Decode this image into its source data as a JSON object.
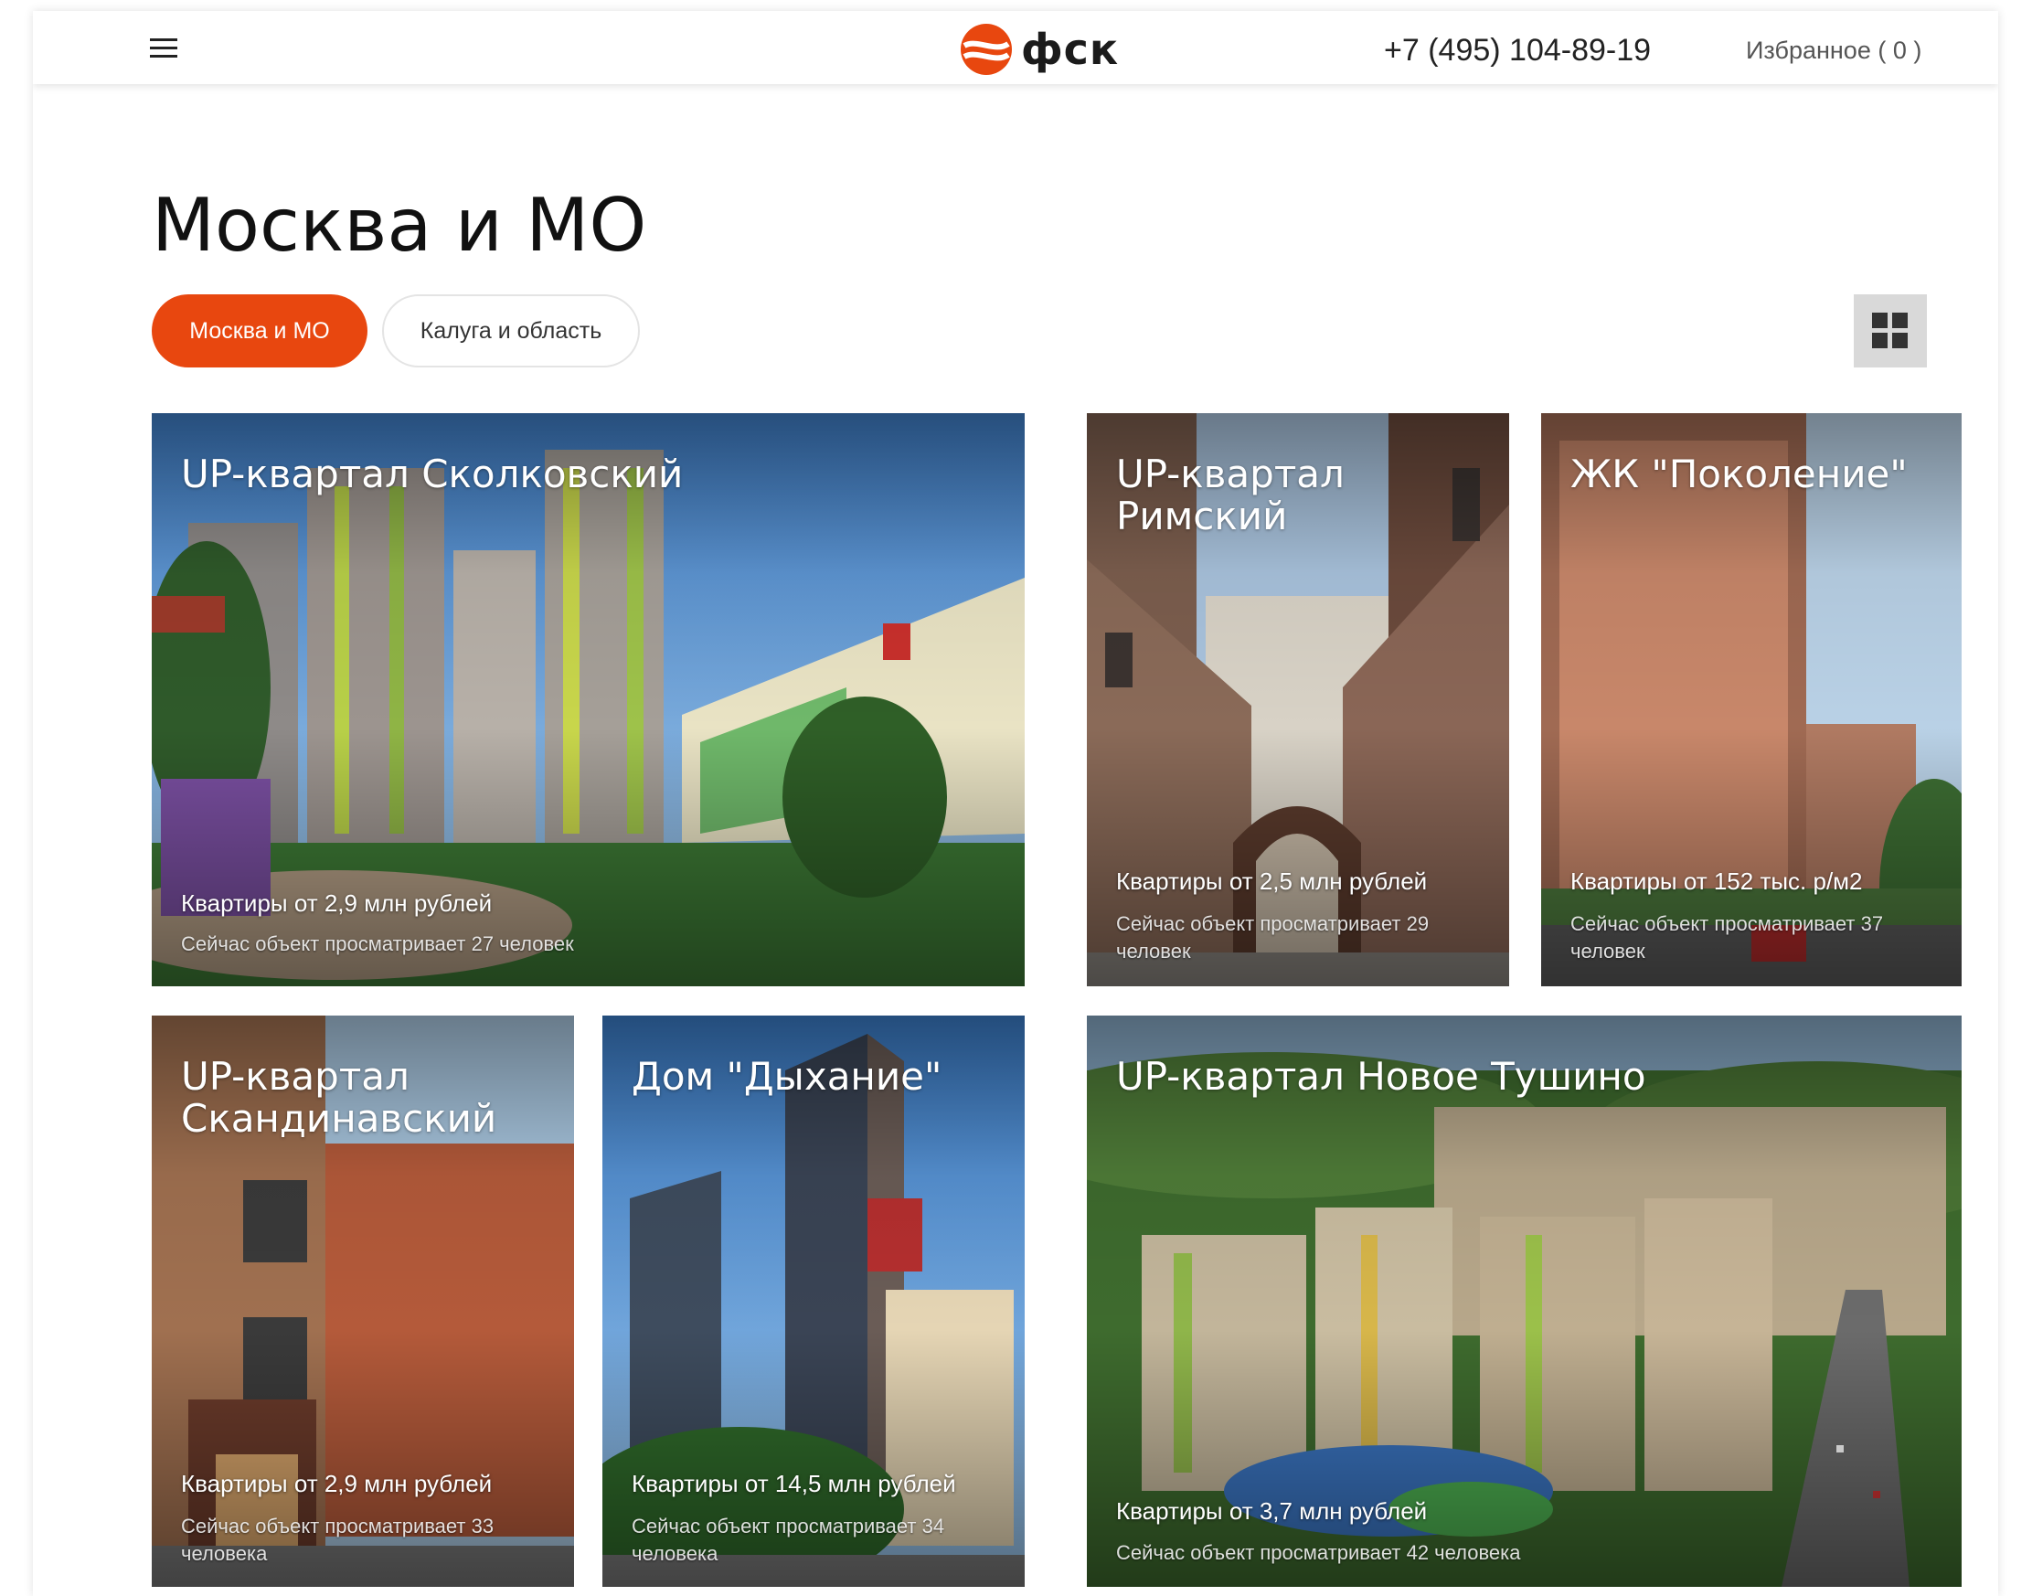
{
  "header": {
    "logo_text": "фск",
    "phone": "+7 (495) 104-89-19",
    "favorites": "Избранное ( 0 )"
  },
  "page": {
    "title": "Москва и МО",
    "tabs": [
      {
        "label": "Москва и МО",
        "active": true
      },
      {
        "label": "Калуга и область",
        "active": false
      }
    ]
  },
  "projects": [
    {
      "title": "UP-квартал Сколковский",
      "price": "Квартиры от 2,9 млн рублей",
      "views": "Сейчас объект просматривает 27 человек"
    },
    {
      "title": "UP-квартал Римский",
      "price": "Квартиры от 2,5 млн рублей",
      "views": "Сейчас объект просматривает 29 человек"
    },
    {
      "title": "ЖК \"Поколение\"",
      "price": "Квартиры от 152 тыс. р/м2",
      "views": "Сейчас объект просматривает 37 человек"
    },
    {
      "title": "UP-квартал Скандинавский",
      "price": "Квартиры от 2,9 млн рублей",
      "views": "Сейчас объект просматривает 33 человека"
    },
    {
      "title": "Дом \"Дыхание\"",
      "price": "Квартиры от 14,5 млн рублей",
      "views": "Сейчас объект просматривает 34 человека"
    },
    {
      "title": "UP-квартал Новое Тушино",
      "price": "Квартиры от 3,7 млн рублей",
      "views": "Сейчас объект просматривает 42 человека"
    }
  ],
  "colors": {
    "accent": "#e8470f",
    "toggle_bg": "#d9d9d9"
  }
}
